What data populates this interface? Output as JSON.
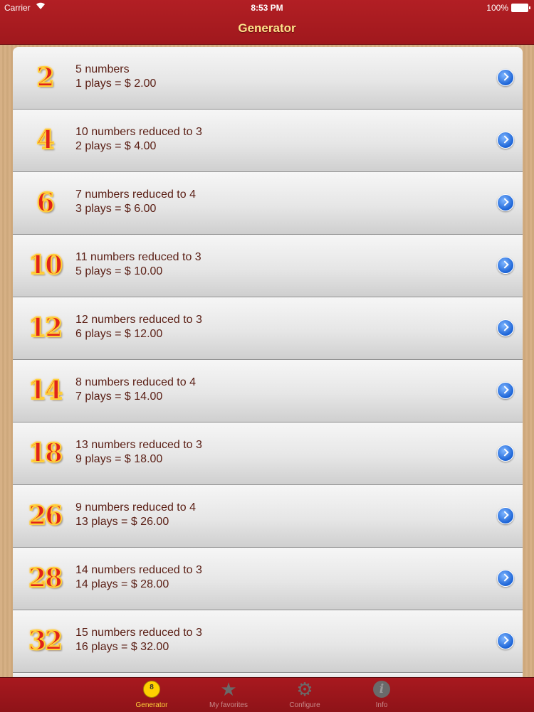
{
  "status": {
    "carrier": "Carrier",
    "time": "8:53 PM",
    "battery": "100%"
  },
  "nav": {
    "title": "Generator"
  },
  "rows": [
    {
      "badge": "2",
      "line1": "5 numbers",
      "line2": "1 plays = $ 2.00"
    },
    {
      "badge": "4",
      "line1": "10 numbers reduced to 3",
      "line2": "2 plays = $ 4.00"
    },
    {
      "badge": "6",
      "line1": "7 numbers reduced to 4",
      "line2": "3 plays = $ 6.00"
    },
    {
      "badge": "10",
      "line1": "11 numbers reduced to 3",
      "line2": "5 plays = $ 10.00"
    },
    {
      "badge": "12",
      "line1": "12 numbers reduced to 3",
      "line2": "6 plays = $ 12.00"
    },
    {
      "badge": "14",
      "line1": "8 numbers reduced to 4",
      "line2": "7 plays = $ 14.00"
    },
    {
      "badge": "18",
      "line1": "13 numbers reduced to 3",
      "line2": "9 plays = $ 18.00"
    },
    {
      "badge": "26",
      "line1": "9 numbers reduced to 4",
      "line2": "13 plays = $ 26.00"
    },
    {
      "badge": "28",
      "line1": "14 numbers reduced to 3",
      "line2": "14 plays = $ 28.00"
    },
    {
      "badge": "32",
      "line1": "15 numbers reduced to 3",
      "line2": "16 plays = $ 32.00"
    }
  ],
  "tabs": [
    {
      "label": "Generator",
      "icon": "eight-ball-icon",
      "active": true
    },
    {
      "label": "My favorites",
      "icon": "star-icon",
      "active": false
    },
    {
      "label": "Configure",
      "icon": "gear-icon",
      "active": false
    },
    {
      "label": "Info",
      "icon": "info-icon",
      "active": false
    }
  ],
  "colors": {
    "bar_red": "#a8191f",
    "title_gold": "#ffe28a",
    "badge_red": "#e0231a",
    "badge_outline": "#ffd23a",
    "row_text": "#5a1e14",
    "disclosure_blue": "#1b63d6"
  }
}
